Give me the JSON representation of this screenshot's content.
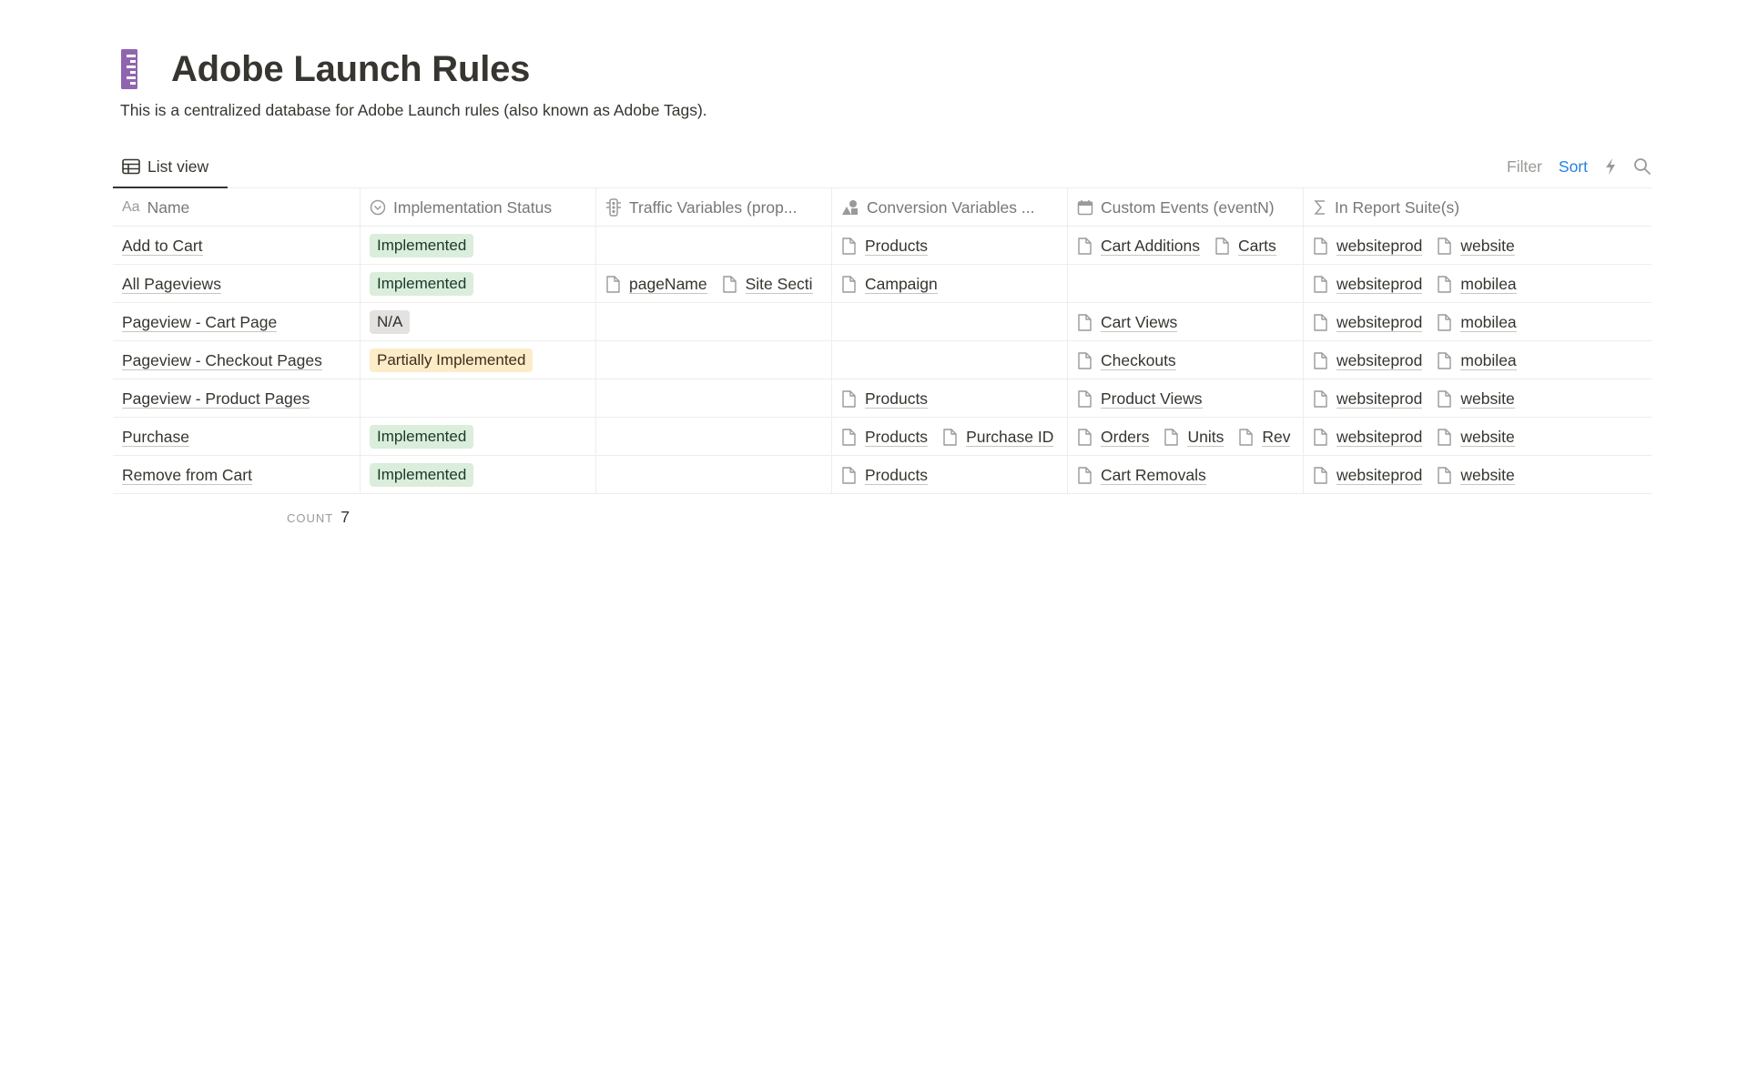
{
  "page": {
    "icon": "ruler-icon",
    "title": "Adobe Launch Rules",
    "description": "This is a centralized database for Adobe Launch rules (also known as Adobe Tags)."
  },
  "view": {
    "tab_label": "List view",
    "filter_label": "Filter",
    "sort_label": "Sort",
    "automation_icon": "lightning-icon",
    "search_icon": "search-icon"
  },
  "table": {
    "columns": [
      {
        "label": "Name",
        "icon": "Aa"
      },
      {
        "label": "Implementation Status",
        "icon": "status-icon"
      },
      {
        "label": "Traffic Variables (prop...",
        "icon": "traffic-light-icon"
      },
      {
        "label": "Conversion Variables ...",
        "icon": "shapes-icon"
      },
      {
        "label": "Custom Events (eventN)",
        "icon": "calendar-icon"
      },
      {
        "label": "In Report Suite(s)",
        "icon": "sigma-icon"
      }
    ],
    "rows": [
      {
        "name": "Add to Cart",
        "status": "Implemented",
        "status_color": "green",
        "traffic": [],
        "conversion": [
          "Products"
        ],
        "events": [
          "Cart Additions",
          "Carts"
        ],
        "suites": [
          "websiteprod",
          "website"
        ]
      },
      {
        "name": "All Pageviews",
        "status": "Implemented",
        "status_color": "green",
        "traffic": [
          "pageName",
          "Site Secti"
        ],
        "conversion": [
          "Campaign"
        ],
        "events": [],
        "suites": [
          "websiteprod",
          "mobilea"
        ]
      },
      {
        "name": "Pageview - Cart Page",
        "status": "N/A",
        "status_color": "gray",
        "traffic": [],
        "conversion": [],
        "events": [
          "Cart Views"
        ],
        "suites": [
          "websiteprod",
          "mobilea"
        ]
      },
      {
        "name": "Pageview - Checkout Pages",
        "status": "Partially Implemented",
        "status_color": "yellow",
        "traffic": [],
        "conversion": [],
        "events": [
          "Checkouts"
        ],
        "suites": [
          "websiteprod",
          "mobilea"
        ]
      },
      {
        "name": "Pageview - Product Pages",
        "status": "",
        "status_color": "",
        "traffic": [],
        "conversion": [
          "Products"
        ],
        "events": [
          "Product Views"
        ],
        "suites": [
          "websiteprod",
          "website"
        ]
      },
      {
        "name": "Purchase",
        "status": "Implemented",
        "status_color": "green",
        "traffic": [],
        "conversion": [
          "Products",
          "Purchase ID"
        ],
        "events": [
          "Orders",
          "Units",
          "Rev"
        ],
        "suites": [
          "websiteprod",
          "website"
        ]
      },
      {
        "name": "Remove from Cart",
        "status": "Implemented",
        "status_color": "green",
        "traffic": [],
        "conversion": [
          "Products"
        ],
        "events": [
          "Cart Removals"
        ],
        "suites": [
          "websiteprod",
          "website"
        ]
      }
    ],
    "count_label": "COUNT",
    "count_value": "7"
  },
  "colors": {
    "accent": "#2383e2",
    "icon_purple": "#9065b0",
    "green_tag": "#dbeddb",
    "yellow_tag": "#fdecc8",
    "gray_tag": "#e3e2e0"
  }
}
